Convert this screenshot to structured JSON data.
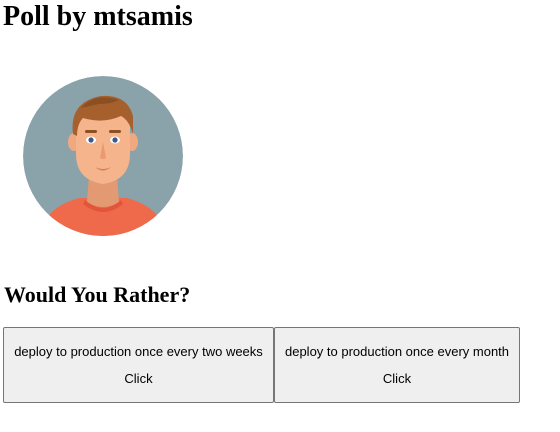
{
  "poll": {
    "title": "Poll by mtsamis",
    "avatar": "user-avatar-illustration",
    "question": "Would You Rather?",
    "options": [
      {
        "text": "deploy to production once every two weeks",
        "action": "Click"
      },
      {
        "text": "deploy to production once every month",
        "action": "Click"
      }
    ]
  },
  "colors": {
    "avatar_bg": "#8aa3ab",
    "skin": "#f5b48c",
    "hair": "#a5602d",
    "shirt": "#ee6a4a",
    "button_bg": "#efefef",
    "button_border": "#767676"
  }
}
